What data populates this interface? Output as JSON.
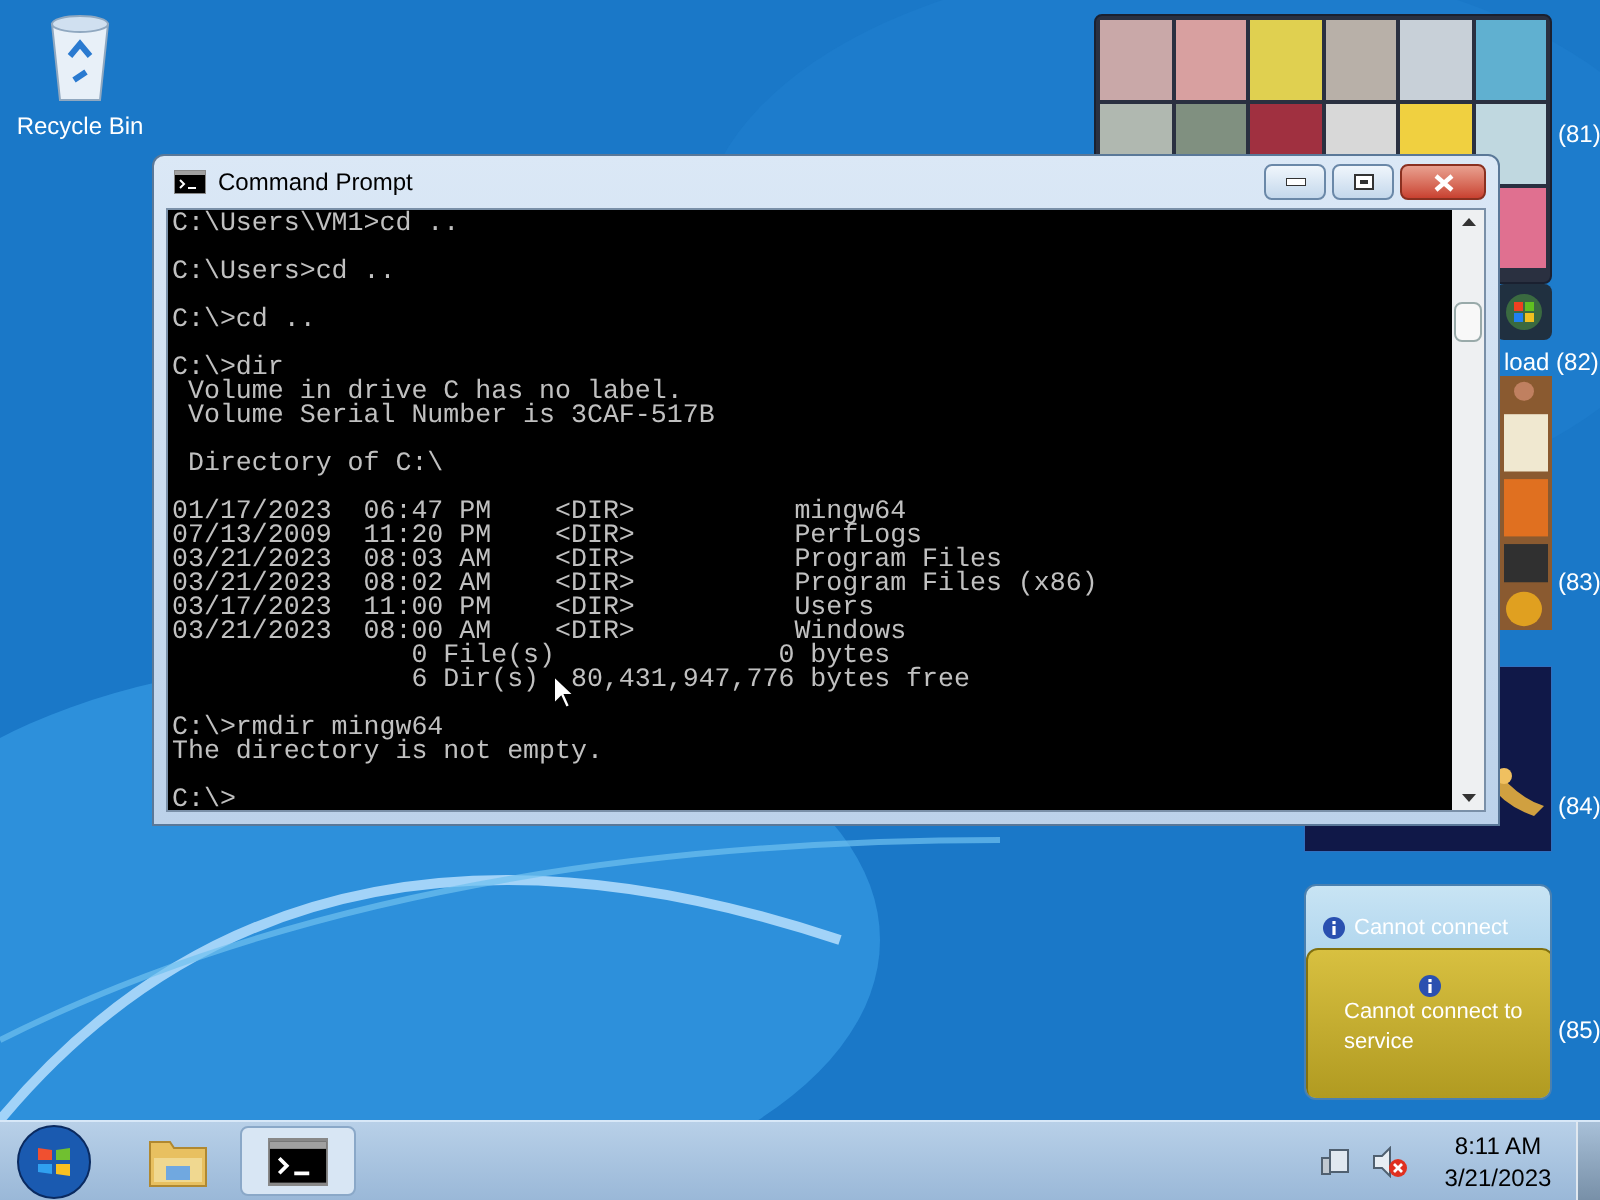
{
  "desktop_icons": [
    {
      "label": "Recycle Bin"
    }
  ],
  "gadgets": [
    {
      "kind": "tiles",
      "label": "(81)"
    },
    {
      "kind": "logo",
      "label": "load (82)"
    },
    {
      "label": "(83)"
    },
    {
      "kind": "dark",
      "label": "(84)"
    },
    {
      "kind": "service",
      "header": "Cannot connect",
      "message": "Cannot connect to service",
      "label": "(85)"
    }
  ],
  "window": {
    "title": "Command Prompt",
    "console": [
      [
        "C:\\Users\\VM1>cd .."
      ],
      [
        "C:\\Users>cd .."
      ],
      [
        "C:\\>cd .."
      ],
      [
        "C:\\>dir",
        " Volume in drive C has no label.",
        " Volume Serial Number is 3CAF-517B"
      ],
      [
        " Directory of C:\\"
      ],
      [
        "01/17/2023  06:47 PM    <DIR>          mingw64",
        "07/13/2009  11:20 PM    <DIR>          PerfLogs",
        "03/21/2023  08:03 AM    <DIR>          Program Files",
        "03/21/2023  08:02 AM    <DIR>          Program Files (x86)",
        "03/17/2023  11:00 PM    <DIR>          Users",
        "03/21/2023  08:00 AM    <DIR>          Windows",
        "               0 File(s)              0 bytes",
        "               6 Dir(s)  80,431,947,776 bytes free"
      ],
      [
        "C:\\>rmdir mingw64",
        "The directory is not empty."
      ],
      [
        "C:\\>"
      ]
    ]
  },
  "taskbar": {
    "items": [
      {
        "kind": "explorer",
        "selected": false
      },
      {
        "kind": "console",
        "selected": true
      }
    ],
    "time": "8:11 AM",
    "date": "3/21/2023"
  }
}
